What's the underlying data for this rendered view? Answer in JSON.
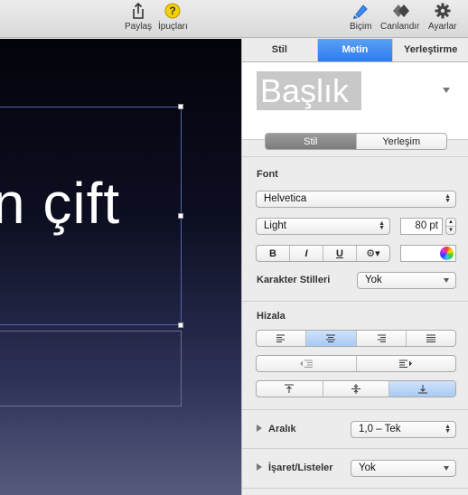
{
  "toolbar": {
    "share_label": "Paylaş",
    "tips_label": "İpuçları",
    "format_label": "Biçim",
    "animate_label": "Canlandır",
    "settings_label": "Ayarlar",
    "accent": "#2f7ef0"
  },
  "canvas": {
    "slide_text": "n çift"
  },
  "inspector": {
    "tabs": [
      "Stil",
      "Metin",
      "Yerleştirme"
    ],
    "active_tab": "Metin",
    "paragraph_style_preview": "Başlık",
    "subtabs": [
      "Stil",
      "Yerleşim"
    ],
    "active_subtab": "Stil",
    "font": {
      "section_title": "Font",
      "family": "Helvetica",
      "typeface": "Light",
      "size": "80 pt",
      "bold": "B",
      "italic": "I",
      "underline": "U"
    },
    "character_styles": {
      "label": "Karakter Stilleri",
      "value": "Yok"
    },
    "alignment": {
      "section_title": "Hizala",
      "active_horizontal": "center",
      "active_vertical": "bottom"
    },
    "spacing": {
      "label": "Aralık",
      "value": "1,0 – Tek"
    },
    "bullets": {
      "label": "İşaret/Listeler",
      "value": "Yok"
    }
  }
}
